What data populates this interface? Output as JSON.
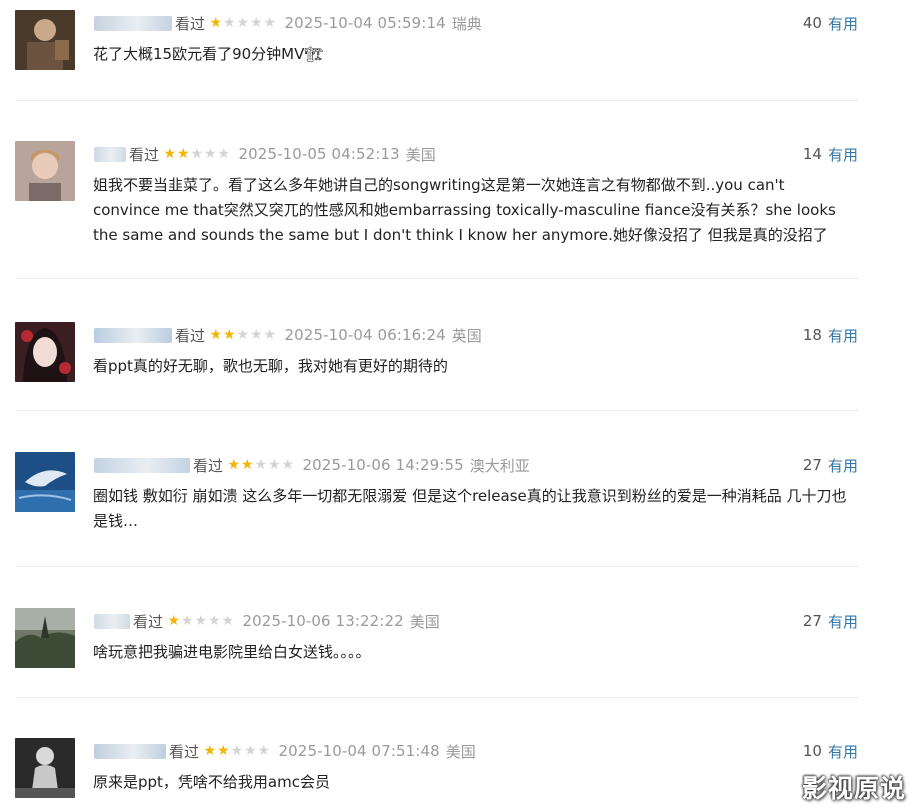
{
  "comments": [
    {
      "name_blur_color": "#c5d2de",
      "status": "看过",
      "rating": 1,
      "time": "2025-10-04 05:59:14",
      "location": "瑞典",
      "votes": "40",
      "useful_label": "有用",
      "text": "花了大概15欧元看了90分钟MV🏗"
    },
    {
      "name_blur_color": "#cfd9e3",
      "status": "看过",
      "rating": 2,
      "time": "2025-10-05 04:52:13",
      "location": "美国",
      "votes": "14",
      "useful_label": "有用",
      "text": "姐我不要当韭菜了。看了这么多年她讲自己的songwriting这是第一次她连言之有物都做不到..you can't convince me that突然又突兀的性感风和她embarrassing toxically-masculine fiance没有关系？she looks the same and sounds the same but I don't think I know her anymore.她好像没招了 但我是真的没招了"
    },
    {
      "name_blur_color": "#b9cde0",
      "status": "看过",
      "rating": 2,
      "time": "2025-10-04 06:16:24",
      "location": "英国",
      "votes": "18",
      "useful_label": "有用",
      "text": "看ppt真的好无聊，歌也无聊，我对她有更好的期待的"
    },
    {
      "name_blur_color": "#c3d3e2",
      "status": "看过",
      "rating": 2,
      "time": "2025-10-06 14:29:55",
      "location": "澳大利亚",
      "votes": "27",
      "useful_label": "有用",
      "text": "圈如钱 敷如衍 崩如溃 这么多年一切都无限溺爱 但是这个release真的让我意识到粉丝的爱是一种消耗品 几十刀也是钱…"
    },
    {
      "name_blur_color": "#d2dbe3",
      "status": "看过",
      "rating": 1,
      "time": "2025-10-06 13:22:22",
      "location": "美国",
      "votes": "27",
      "useful_label": "有用",
      "text": "啥玩意把我骗进电影院里给白女送钱。。。。"
    },
    {
      "name_blur_color": "#c0cfdd",
      "status": "看过",
      "rating": 2,
      "time": "2025-10-04 07:51:48",
      "location": "美国",
      "votes": "10",
      "useful_label": "有用",
      "text": "原来是ppt，凭啥不给我用amc会员"
    }
  ],
  "watermark": "影视原说"
}
